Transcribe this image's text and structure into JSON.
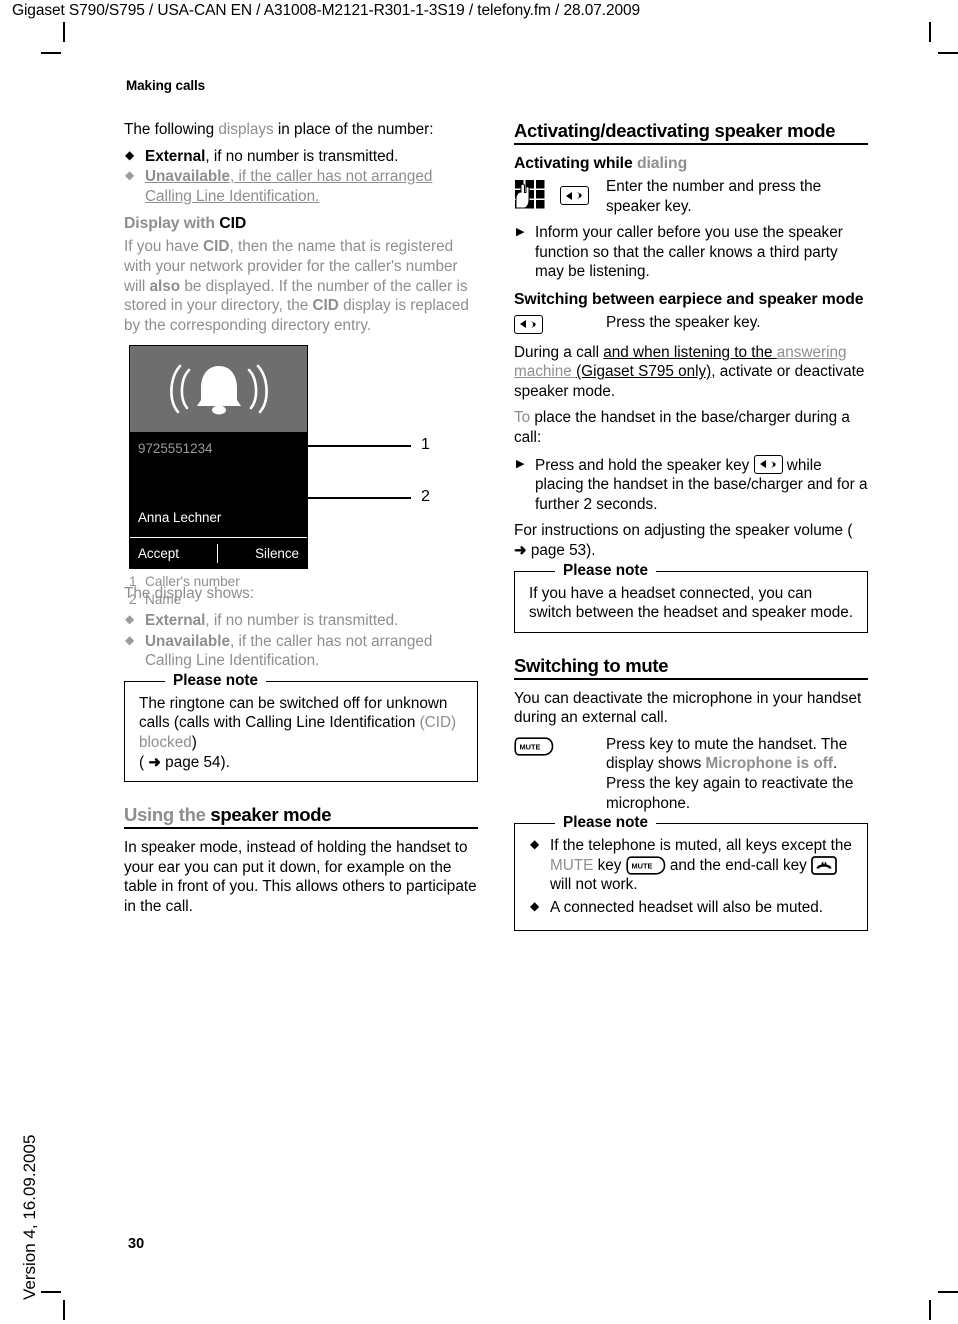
{
  "document": {
    "header": "Gigaset S790/S795 / USA-CAN EN / A31008-M2121-R301-1-3S19 / telefony.fm / 28.07.2009",
    "chapter": "Making calls",
    "page_number": "30",
    "version_margin": "Version 4, 16.09.2005"
  },
  "left_column": {
    "intro": {
      "line1_a": "The following ",
      "line1_b": "displays",
      "line1_c": " in place of the number:"
    },
    "bullets_top": [
      {
        "bold": "External",
        "rest": ", if no number is transmitted.",
        "tone": "black"
      },
      {
        "bold": "Unavailable",
        "rest": ", if the caller has not arranged Calling Line Identification. ",
        "tone": "gray-underline"
      }
    ],
    "cid_heading": {
      "a": "Display with ",
      "b": "CID"
    },
    "cid_paragraph": {
      "t1": "If you have ",
      "b1": "CID",
      "t2": ", then the name that is registered with your network provider for the caller's number will ",
      "b2": "also",
      "t3": " be displayed. If the number of the caller is stored in your directory, the ",
      "b3": "CID",
      "t4": " display is replaced by the corresponding directory entry."
    },
    "figure": {
      "bell_icon": "ringing-bell-icon",
      "caller_number": "9725551234",
      "caller_name": "Anna Lechner",
      "softkey_left": "Accept",
      "softkey_right": "Silence",
      "callout_1": "1",
      "callout_2": "2",
      "legend": [
        {
          "num": "1",
          "text": "Caller's number"
        },
        {
          "num": "2",
          "text": "Name"
        }
      ]
    },
    "display_shows_label": "The display shows:",
    "bullets_bottom": [
      {
        "bold": "External",
        "rest": ", if no number is transmitted."
      },
      {
        "bold": "Unavailable",
        "rest": ", if the caller has not arranged Calling Line Identification."
      }
    ],
    "note": {
      "title": "Please note",
      "t1": "The ringtone can be switched off for unknown calls (calls with Calling Line Identification ",
      "gray": "(CID) blocked",
      "t2": ")",
      "xref_open": "( ",
      "xref_arrow": "➜",
      "xref_page": " page 54",
      "xref_close": ")."
    },
    "speaker_heading": {
      "a": "Using the ",
      "b": "speaker mode"
    },
    "speaker_paragraph": "In speaker mode, instead of holding the handset to your ear you can put it down, for example on the table in front of you. This allows others to participate in the call."
  },
  "right_column": {
    "activating_heading": "Activating/deactivating speaker mode",
    "dialing_heading": {
      "a": "Activating while ",
      "b": "dialing"
    },
    "dialing_row": {
      "icon_keypad": "keypad-digits-icon",
      "icon_speaker": "speaker-key-icon",
      "text": "Enter the number and press the speaker key."
    },
    "inform_step": "Inform your caller before you use the speaker function so that the caller knows a third party may be listening.",
    "switching_heading": "Switching between earpiece and speaker mode",
    "press_speaker_row": {
      "icon_speaker": "speaker-key-icon",
      "text": "Press the speaker key."
    },
    "during_call": {
      "t1": "During a call ",
      "ul_black_1": "and when listening to the ",
      "ul_gray": "answering machine ",
      "ul_black_2": "(Gigaset S795 only)",
      "t2": ", activate or deactivate speaker mode."
    },
    "place_handset": {
      "gray": "To",
      "rest": " place the handset in the base/charger during a call:"
    },
    "press_hold_step": {
      "t1": "Press and hold the speaker key ",
      "icon_speaker": "speaker-key-icon",
      "t2": " while placing the handset in the base/charger and for a further 2 seconds."
    },
    "volume_paragraph": {
      "t1": "For instructions on adjusting the speaker volume ",
      "xref_open": "( ",
      "xref_arrow": "➜",
      "xref_page": " page 53",
      "xref_close": ")."
    },
    "note_headset": {
      "title": "Please note",
      "text": "If you have a headset connected, you can switch between the headset and speaker mode."
    },
    "mute_heading": "Switching to mute",
    "mute_paragraph": "You can deactivate the microphone in your handset during an external call.",
    "mute_row": {
      "icon_mute": "mute-key-icon",
      "t1": "Press key to mute the handset. The display shows ",
      "gray_bold": "Microphone is off",
      "t2": ".",
      "t3": "Press the key again to reactivate the microphone."
    },
    "note_mute": {
      "title": "Please note",
      "bullet1": {
        "t1": "If the telephone is muted, all keys except the ",
        "gray": "MUTE",
        "t2": " key ",
        "icon_mute": "mute-key-icon",
        "t3": " and the end-call key ",
        "icon_endcall": "end-call-key-icon",
        "t4": " will not work."
      },
      "bullet2": "A connected headset will also be muted."
    }
  },
  "icon_labels": {
    "mute_key_text": "MUTE"
  }
}
